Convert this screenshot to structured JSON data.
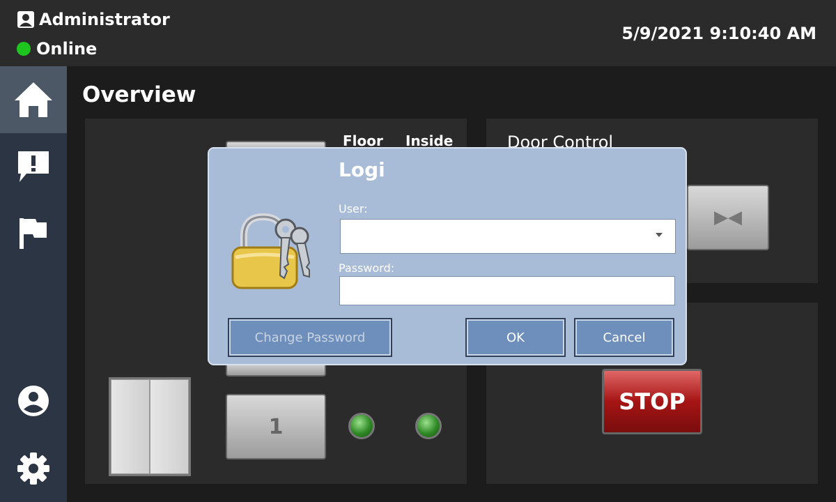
{
  "header": {
    "user_name": "Administrator",
    "status": "Online",
    "status_color": "#1fc51f",
    "datetime": "5/9/2021 9:10:40 AM"
  },
  "sidebar": {
    "items": [
      {
        "icon": "home-icon",
        "active": true
      },
      {
        "icon": "alert-message-icon",
        "active": false
      },
      {
        "icon": "flag-icon",
        "active": false
      },
      {
        "icon": "user-profile-icon",
        "active": false
      },
      {
        "icon": "gear-icon",
        "active": false
      }
    ]
  },
  "main": {
    "title": "Overview",
    "elevator_panel": {
      "col_floor": "Floor",
      "col_inside": "Inside",
      "floor_button_label": "1"
    },
    "door_panel": {
      "title": "Door Control",
      "door_button_symbol": "▶◀"
    },
    "stop_label": "STOP"
  },
  "dialog": {
    "title": "Logi",
    "user_label": "User:",
    "user_value": "",
    "password_label": "Password:",
    "password_value": "",
    "change_password_label": "Change Password",
    "ok_label": "OK",
    "cancel_label": "Cancel"
  }
}
